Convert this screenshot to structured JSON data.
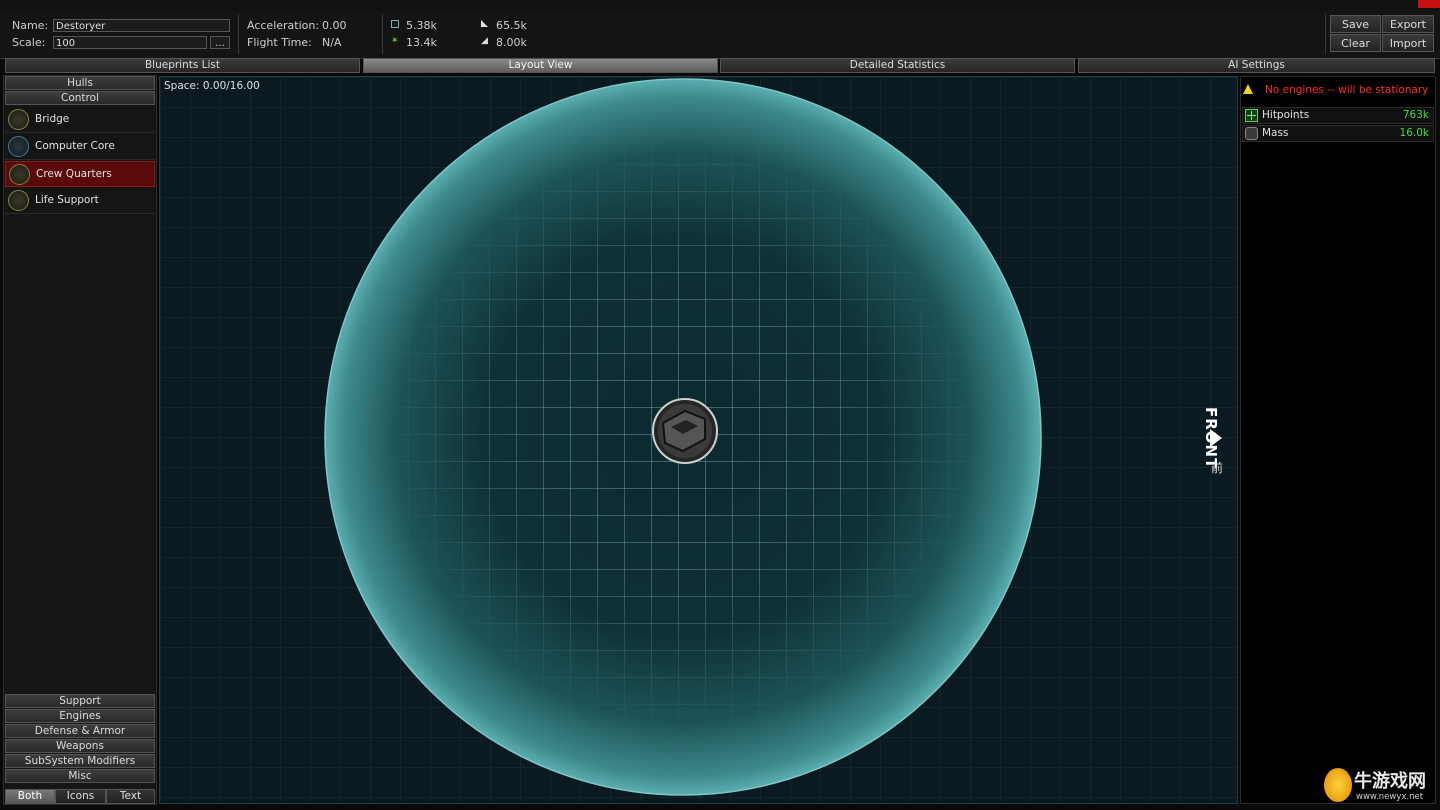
{
  "window": {
    "accent_color": "#c81010"
  },
  "header": {
    "name_label": "Name:",
    "name_value": "Destoryer",
    "scale_label": "Scale:",
    "scale_value": "100",
    "scale_more": "...",
    "acceleration_label": "Acceleration:",
    "acceleration_value": "0.00",
    "flight_time_label": "Flight Time:",
    "flight_time_value": "N/A",
    "stats": [
      {
        "icon": "hull-icon",
        "value": "5.38k"
      },
      {
        "icon": "shield-stat-icon",
        "value": "65.5k"
      },
      {
        "icon": "crew-icon",
        "value": "13.4k"
      },
      {
        "icon": "supply-icon",
        "value": "8.00k"
      }
    ],
    "buttons": {
      "save": "Save",
      "export": "Export",
      "clear": "Clear",
      "import": "Import"
    }
  },
  "tabs": [
    {
      "label": "Blueprints List",
      "active": false
    },
    {
      "label": "Layout View",
      "active": true
    },
    {
      "label": "Detailed Statistics",
      "active": false
    },
    {
      "label": "AI Settings",
      "active": false
    }
  ],
  "left_panel": {
    "top_categories": [
      "Hulls",
      "Control"
    ],
    "items": [
      {
        "label": "Bridge",
        "icon": "bridge-icon",
        "selected": false
      },
      {
        "label": "Computer Core",
        "icon": "computer-core-icon",
        "selected": false
      },
      {
        "label": "Crew Quarters",
        "icon": "crew-quarters-icon",
        "selected": true
      },
      {
        "label": "Life Support",
        "icon": "life-support-icon",
        "selected": false
      }
    ],
    "bottom_categories": [
      "Support",
      "Engines",
      "Defense & Armor",
      "Weapons",
      "SubSystem Modifiers",
      "Misc"
    ],
    "filters": [
      {
        "label": "Both",
        "active": true
      },
      {
        "label": "Icons",
        "active": false
      },
      {
        "label": "Text",
        "active": false
      }
    ]
  },
  "layout_view": {
    "space_label": "Space: 0.00/16.00",
    "front_label": "FRONT",
    "front_cjk": "前",
    "grid_color": "#3f8a8f"
  },
  "right_panel": {
    "warning": "No engines -- will be stationary",
    "warning_color": "#ff2a2a",
    "stats": [
      {
        "name": "Hitpoints",
        "value": "763k",
        "icon": "hitpoints-icon"
      },
      {
        "name": "Mass",
        "value": "16.0k",
        "icon": "mass-icon"
      }
    ],
    "value_color": "#3ddc3d"
  },
  "watermark": {
    "text_cn": "牛游戏网",
    "text_url": "www.newyx.net"
  }
}
